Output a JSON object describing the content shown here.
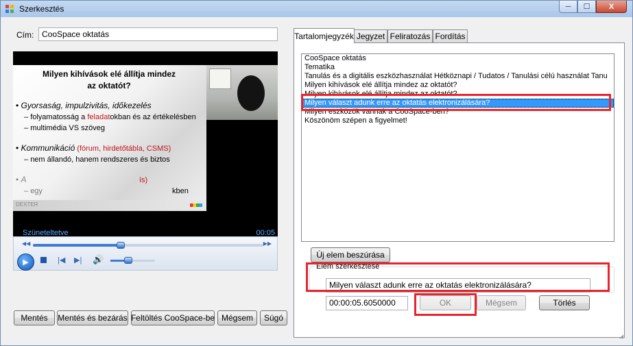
{
  "window": {
    "title": "Szerkesztés",
    "controls": {
      "minimize": "─",
      "maximize": "☐",
      "close": "X"
    }
  },
  "form": {
    "title_label": "Cím:",
    "title_value": "CooSpace oktatás"
  },
  "video": {
    "status": "Szüneteltetve",
    "time": "00:05",
    "seek_progress": 0.38,
    "volume_level": 0.4,
    "slide": {
      "heading_line1": "Milyen kihívások elé állítja mindez",
      "heading_line2": "az oktatót?",
      "b1": "Gyorsaság, impulzivitás, időkezelés",
      "b1a_pre": "folyamatosság  a ",
      "b1a_red": "feladat",
      "b1a_post": "okban és az értékelésben",
      "b1b": "multimédia VS szöveg",
      "b2": "Kommunikáció",
      "b2_red": " (fórum, hirdetőtábla, CSMS)",
      "b2a": "nem állandó, hanem rendszeres és biztos",
      "b3_letter": "A",
      "b3_red": "ís)",
      "b3a_pre": "egy",
      "b3a_post": "kben",
      "footer": "DEXTER"
    }
  },
  "buttons": {
    "save": "Mentés",
    "save_close": "Mentés és bezárás",
    "upload": "Feltöltés CooSpace-be",
    "cancel": "Mégsem",
    "help": "Súgó"
  },
  "tabs": [
    {
      "label": "Tartalomjegyzék",
      "active": true
    },
    {
      "label": "Jegyzet",
      "active": false
    },
    {
      "label": "Feliratozás",
      "active": false
    },
    {
      "label": "Fordítás",
      "active": false
    }
  ],
  "toc": {
    "items": [
      "CooSpace oktatás",
      "Tematika",
      "Tanulás és a digitális eszközhasználat Hétköznapi / Tudatos / Tanulási célú használat Tanu",
      "Milyen kihívások elé állítja mindez az oktatót?",
      "Milyen kihívások elé állítja mindez az oktatót?",
      "Milyen választ adunk erre az oktatás elektronizálására?",
      "Milyen eszközök vannak a CooSpace-ben?",
      "Köszönöm szépen a figyelmet!"
    ],
    "selected_index": 5,
    "new_item_button": "Új elem beszúrása"
  },
  "edit": {
    "group_label": "Elem szerkesztése",
    "text_value": "Milyen választ adunk erre az oktatás elektronizálására?",
    "time_value": "00:00:05.6050000",
    "ok": "OK",
    "cancel": "Mégsem",
    "delete": "Törlés"
  }
}
